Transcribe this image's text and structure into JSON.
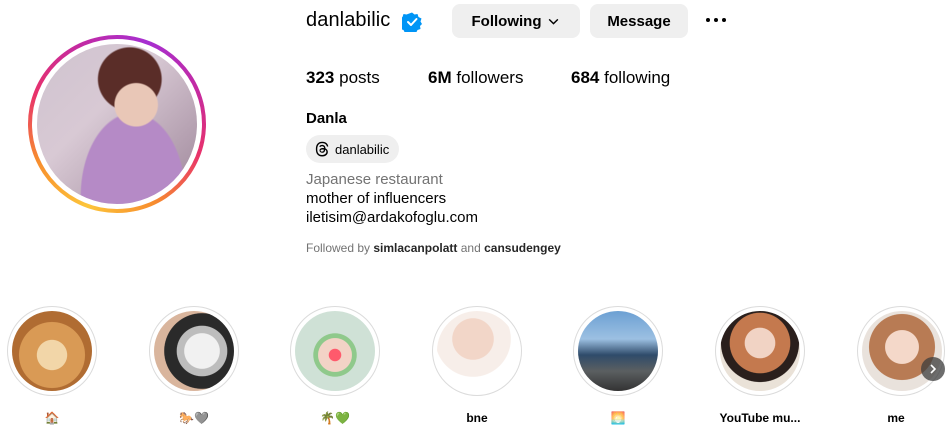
{
  "profile": {
    "username": "danlabilic",
    "full_name": "Danla",
    "threads_handle": "danlabilic",
    "category": "Japanese restaurant",
    "bio_line1": "mother of influencers",
    "bio_line2": "iletisim@ardakofoglu.com",
    "followed_by_prefix": "Followed by",
    "followed_by_user1": "simlacanpolatt",
    "followed_by_and": "and",
    "followed_by_user2": "cansudengey"
  },
  "actions": {
    "following_label": "Following",
    "message_label": "Message"
  },
  "stats": {
    "posts_count": "323",
    "posts_label": "posts",
    "followers_count": "6M",
    "followers_label": "followers",
    "following_count": "684",
    "following_label": "following"
  },
  "highlights": [
    {
      "label": "🏠"
    },
    {
      "label": "🐎🩶"
    },
    {
      "label": "🌴💚"
    },
    {
      "label": "bne"
    },
    {
      "label": "🌅"
    },
    {
      "label": "YouTube mu..."
    },
    {
      "label": "me"
    }
  ],
  "colors": {
    "verified": "#0095f6",
    "button_bg": "#efefef",
    "secondary_text": "#737373"
  }
}
